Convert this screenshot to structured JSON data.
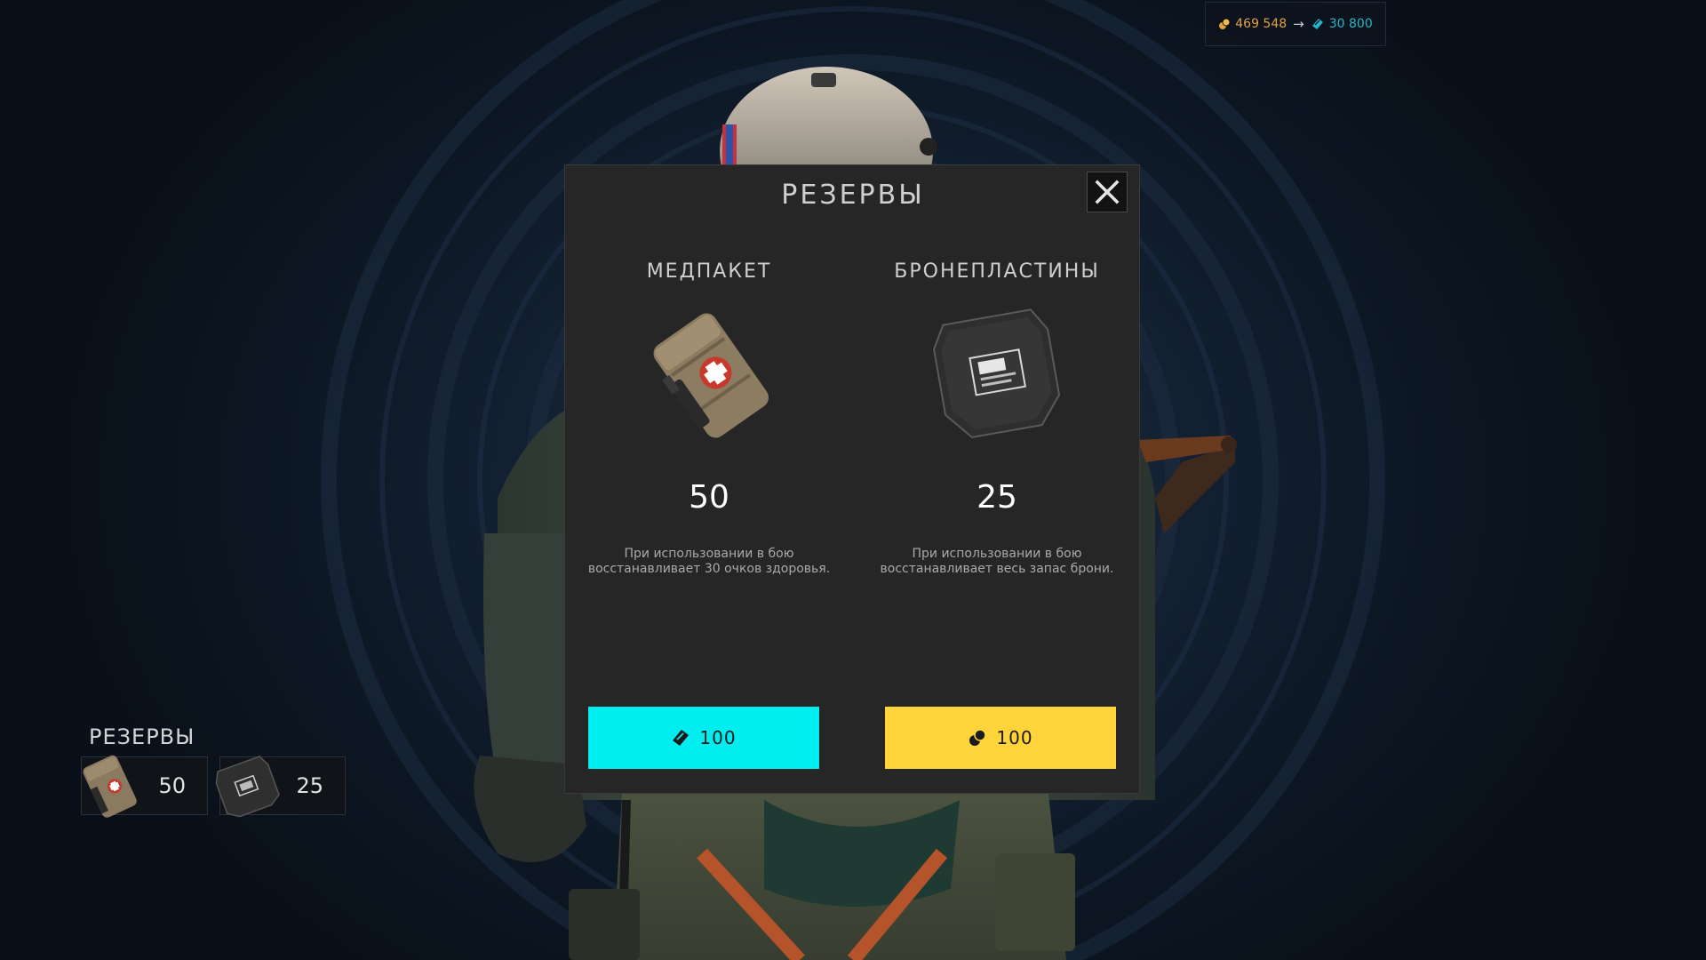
{
  "currency": {
    "gold_icon": "coin-pile-icon",
    "gold_amount": "469 548",
    "arrow": "→",
    "crystal_icon": "crystal-icon",
    "crystal_amount": "30 800",
    "gold_color": "#e0a23a",
    "crystal_color": "#22b8c8"
  },
  "modal": {
    "title": "РЕЗЕРВЫ",
    "close_icon": "close-icon",
    "items": [
      {
        "name": "МЕДПАКЕТ",
        "icon": "medkit-pouch-icon",
        "count": "50",
        "description": "При использовании в бою восстанавливает 30 очков здоровья.",
        "price": "100",
        "price_icon": "crystal-icon",
        "button_color": "#00eef0"
      },
      {
        "name": "БРОНЕПЛАСТИНЫ",
        "icon": "armor-plate-icon",
        "count": "25",
        "description": "При использовании в бою восстанавливает весь запас брони.",
        "price": "100",
        "price_icon": "coin-pile-icon",
        "button_color": "#ffd43a"
      }
    ]
  },
  "reserves_panel": {
    "title": "РЕЗЕРВЫ",
    "slots": [
      {
        "icon": "medkit-pouch-icon",
        "count": "50"
      },
      {
        "icon": "armor-plate-icon",
        "count": "25"
      }
    ]
  }
}
